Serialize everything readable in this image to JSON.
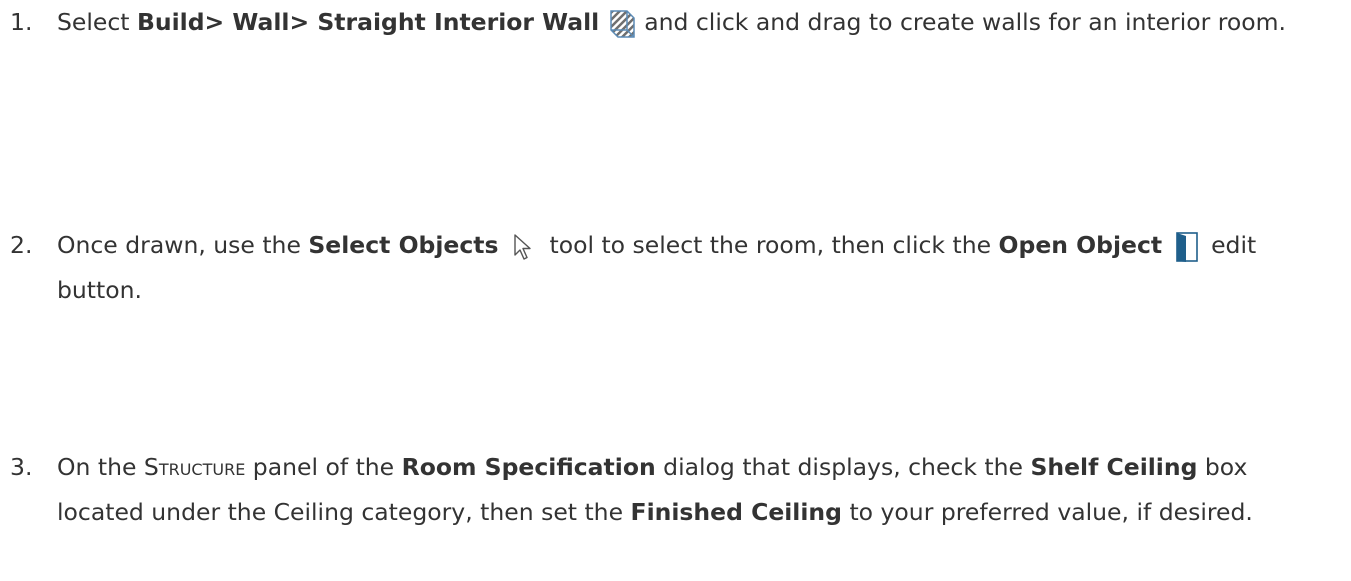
{
  "steps": [
    {
      "number": "1.",
      "p1": "Select ",
      "b1": "Build> Wall> Straight Interior Wall",
      "p2": " and click and drag to create walls for an interior room.",
      "icon": "straight-interior-wall-icon"
    },
    {
      "number": "2.",
      "p1": "Once drawn, use the ",
      "b1": "Select Objects",
      "p2": " tool to select the room, then click the ",
      "b2": "Open Object",
      "p3": " edit button.",
      "icons": [
        "select-objects-arrow-icon",
        "open-object-door-icon"
      ]
    },
    {
      "number": "3.",
      "p1": "On the ",
      "sc1": "Structure",
      "p2": " panel of the ",
      "b1": "Room Specification",
      "p3": " dialog that displays, check the ",
      "b2": "Shelf Ceiling",
      "p4": " box located under the Ceiling category, then set the ",
      "b3": "Finished Ceiling",
      "p5": " to your preferred value, if desired."
    }
  ],
  "colors": {
    "text": "#333333",
    "wall_icon_blue": "#5a8ab5",
    "door_icon_blue": "#1f5f8b"
  }
}
